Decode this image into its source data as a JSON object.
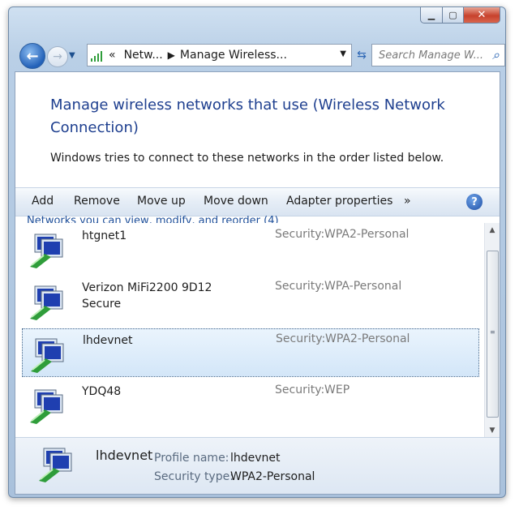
{
  "window": {
    "min_symbol": "▁",
    "max_symbol": "▢",
    "close_symbol": "✕"
  },
  "nav": {
    "back_icon": "back-arrow",
    "forward_icon": "forward-arrow",
    "breadcrumb": [
      "«",
      "Netw...",
      "Manage Wireless..."
    ],
    "search_placeholder": "Search Manage W..."
  },
  "heading": "Manage wireless networks that use (Wireless Network Connection)",
  "subtext": "Windows tries to connect to these networks in the order listed below.",
  "toolbar": {
    "items": [
      "Add",
      "Remove",
      "Move up",
      "Move down",
      "Adapter properties"
    ],
    "more": "»",
    "help": "?"
  },
  "group_header": "Networks you can view, modify, and reorder (4)",
  "networks": [
    {
      "name": "htgnet1",
      "security_label": "Security:",
      "security": "WPA2-Personal",
      "selected": false
    },
    {
      "name": "Verizon MiFi2200 9D12 Secure",
      "security_label": "Security:",
      "security": "WPA-Personal",
      "selected": false
    },
    {
      "name": "lhdevnet",
      "security_label": "Security:",
      "security": "WPA2-Personal",
      "selected": true
    },
    {
      "name": "YDQ48",
      "security_label": "Security:",
      "security": "WEP",
      "selected": false
    }
  ],
  "details": {
    "name": "lhdevnet",
    "profile_label": "Profile name:",
    "profile_value": "lhdevnet",
    "security_label": "Security type:",
    "security_value": "WPA2-Personal"
  },
  "colors": {
    "heading": "#1e3f8f",
    "selection": "#d3e6f8",
    "accent": "#2361b8"
  }
}
